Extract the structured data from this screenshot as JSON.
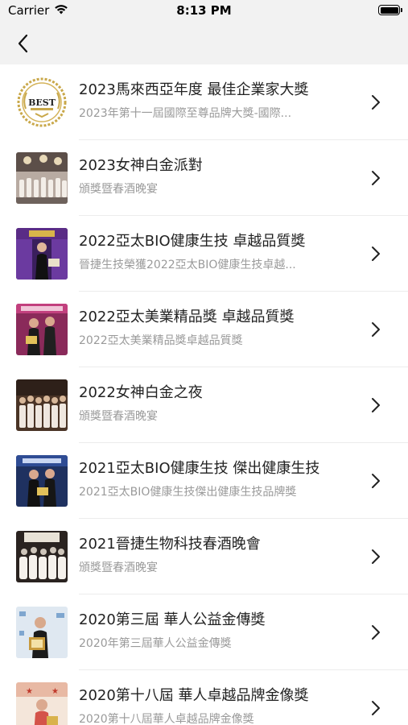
{
  "status_bar": {
    "carrier": "Carrier",
    "time": "8:13 PM",
    "icons": [
      "wifi-icon",
      "battery-icon"
    ]
  },
  "nav": {
    "back_icon": "chevron-left-icon"
  },
  "awards": [
    {
      "title": "2023馬來西亞年度 最佳企業家大獎",
      "subtitle": "2023年第十一屆國際至尊品牌大獎-國際...",
      "thumb": "best-award-seal"
    },
    {
      "title": "2023女神白金派對",
      "subtitle": "頒獎暨春酒晚宴",
      "thumb": "banquet-hall-photo"
    },
    {
      "title": "2022亞太BIO健康生技 卓越品質獎",
      "subtitle": "晉捷生技榮獲2022亞太BIO健康生技卓越...",
      "thumb": "stage-speaker-photo"
    },
    {
      "title": "2022亞太美業精品獎 卓越品質獎",
      "subtitle": "2022亞太美業精品獎卓越品質獎",
      "thumb": "award-couple-photo"
    },
    {
      "title": "2022女神白金之夜",
      "subtitle": "頒獎暨春酒晚宴",
      "thumb": "group-gala-photo"
    },
    {
      "title": "2021亞太BIO健康生技 傑出健康生技",
      "subtitle": "2021亞太BIO健康生技傑出健康生技品牌獎",
      "thumb": "award-couple-photo-2"
    },
    {
      "title": "2021晉捷生物科技春酒晚會",
      "subtitle": "頒獎暨春酒晚宴",
      "thumb": "party-crowd-photo"
    },
    {
      "title": "2020第三屆 華人公益金傳獎",
      "subtitle": "2020年第三屆華人公益金傳獎",
      "thumb": "man-with-certificate-photo"
    },
    {
      "title": "2020第十八屆 華人卓越品牌金像獎",
      "subtitle": "2020第十八屆華人卓越品牌金像獎",
      "thumb": "woman-with-award-photo"
    }
  ],
  "row_chevron_icon": "chevron-right-icon"
}
